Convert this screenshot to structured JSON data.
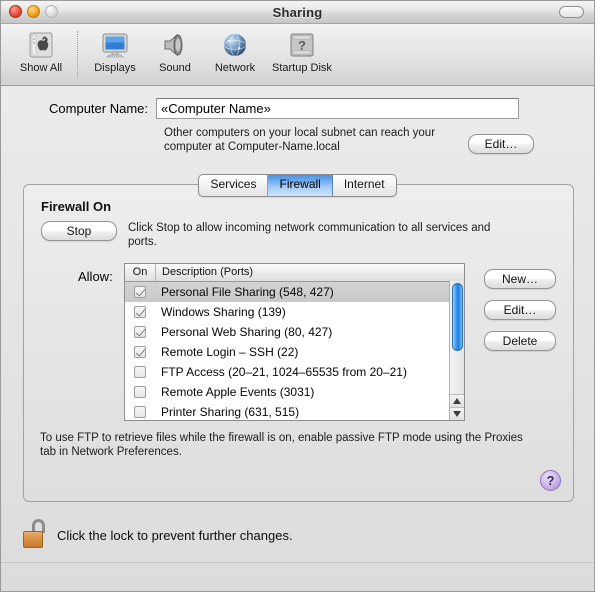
{
  "window": {
    "title": "Sharing",
    "controls": {
      "close": "close-button",
      "minimize": "minimize-button",
      "zoom": "zoom-button"
    },
    "toolbar_toggle": "toolbar-toggle-pill"
  },
  "toolbar": {
    "items": [
      {
        "label": "Show All",
        "icon": "show-all-icon"
      },
      {
        "label": "Displays",
        "icon": "displays-icon"
      },
      {
        "label": "Sound",
        "icon": "sound-icon"
      },
      {
        "label": "Network",
        "icon": "network-icon"
      },
      {
        "label": "Startup Disk",
        "icon": "startup-disk-icon"
      }
    ]
  },
  "computer_name": {
    "label": "Computer Name:",
    "value": "«Computer Name»",
    "placeholder": "«Computer Name»",
    "subnet_note": "Other computers on your local subnet can reach your computer at Computer-Name.local",
    "edit_button": "Edit…"
  },
  "tabs": [
    {
      "label": "Services",
      "active": false
    },
    {
      "label": "Firewall",
      "active": true
    },
    {
      "label": "Internet",
      "active": false
    }
  ],
  "firewall": {
    "state_label": "Firewall On",
    "toggle_button": "Stop",
    "toggle_description": "Click Stop to allow incoming network communication to all services and ports.",
    "allow_label": "Allow:",
    "columns": [
      "On",
      "Description (Ports)"
    ],
    "services": [
      {
        "on": true,
        "description": "Personal File Sharing (548, 427)",
        "selected": true
      },
      {
        "on": true,
        "description": "Windows Sharing (139)",
        "selected": false
      },
      {
        "on": true,
        "description": "Personal Web Sharing (80, 427)",
        "selected": false
      },
      {
        "on": true,
        "description": "Remote Login – SSH (22)",
        "selected": false
      },
      {
        "on": false,
        "description": "FTP Access (20–21, 1024–65535 from 20–21)",
        "selected": false
      },
      {
        "on": false,
        "description": "Remote Apple Events (3031)",
        "selected": false
      },
      {
        "on": false,
        "description": "Printer Sharing (631, 515)",
        "selected": false
      }
    ],
    "side_buttons": [
      {
        "label": "New…"
      },
      {
        "label": "Edit…"
      },
      {
        "label": "Delete"
      }
    ],
    "note": "To use FTP to retrieve files while the firewall is on, enable passive FTP mode using the Proxies tab in Network Preferences.",
    "help_button": "?"
  },
  "lock": {
    "text": "Click the lock to prevent further changes.",
    "icon": "unlocked-padlock-icon"
  },
  "colors": {
    "accent_blue": "#4b91e8",
    "scroll_thumb": "#1e7ddc",
    "help_purple": "#a98fd4",
    "lock_body": "#d99043",
    "window_bg": "#e6e6e6"
  }
}
